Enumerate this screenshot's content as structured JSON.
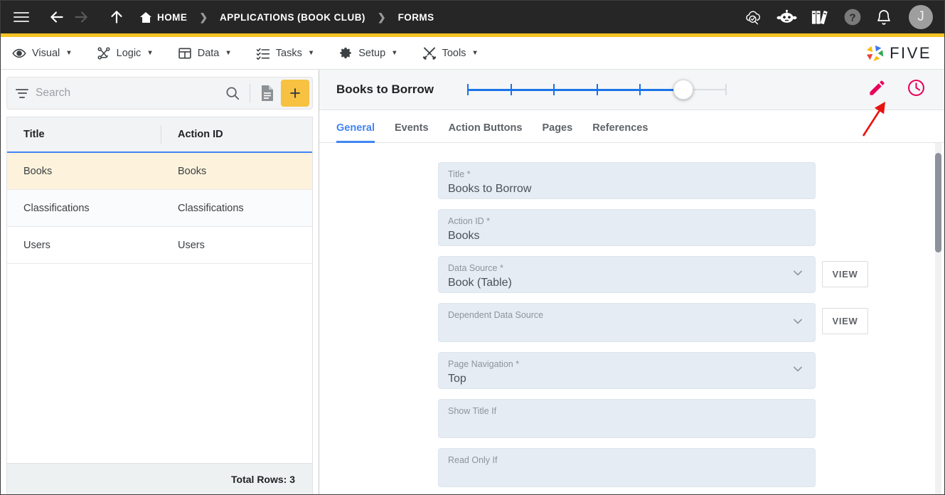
{
  "topbar": {
    "menu_icon": "hamburger-icon",
    "back_label": "←",
    "forward_label": "→",
    "up_label": "↑",
    "breadcrumb": [
      {
        "label": "HOME",
        "icon": "home-icon"
      },
      {
        "label": "APPLICATIONS (BOOK CLUB)",
        "icon": ""
      },
      {
        "label": "FORMS",
        "icon": ""
      }
    ],
    "separator": "❯",
    "icons": [
      {
        "name": "cloud-search-icon"
      },
      {
        "name": "chat-bot-icon"
      },
      {
        "name": "books-icon"
      },
      {
        "name": "help-icon"
      },
      {
        "name": "notifications-bell-icon"
      }
    ],
    "avatar_initial": "J",
    "accent_bar_color": "#f6c324",
    "background_color": "#262626"
  },
  "menubar": {
    "items": [
      {
        "label": "Visual",
        "icon": "eye-icon",
        "caret": "▼"
      },
      {
        "label": "Logic",
        "icon": "logic-nodes-icon",
        "caret": "▼"
      },
      {
        "label": "Data",
        "icon": "table-grid-icon",
        "caret": "▼"
      },
      {
        "label": "Tasks",
        "icon": "checklist-icon",
        "caret": "▼"
      },
      {
        "label": "Setup",
        "icon": "gear-icon",
        "caret": "▼"
      },
      {
        "label": "Tools",
        "icon": "tools-cross-icon",
        "caret": "▼"
      }
    ],
    "logo_text": "FIVE"
  },
  "sidebar": {
    "search": {
      "placeholder": "Search",
      "filter_icon": "filter-icon",
      "search_icon": "search-icon",
      "document_icon": "document-icon",
      "add_label": "+"
    },
    "table": {
      "columns": [
        "Title",
        "Action ID"
      ],
      "rows": [
        {
          "title": "Books",
          "action_id": "Books",
          "selected": true
        },
        {
          "title": "Classifications",
          "action_id": "Classifications",
          "selected": false
        },
        {
          "title": "Users",
          "action_id": "Users",
          "selected": false
        }
      ],
      "footer": "Total Rows: 3",
      "selected_row_color": "#fdf3dd"
    }
  },
  "main": {
    "title": "Books to Borrow",
    "slider": {
      "ticks": 7,
      "value": 6,
      "max": 7,
      "fill_color": "#1a73e8"
    },
    "header_icons": [
      {
        "name": "edit-pencil-icon",
        "color": "#e8005a"
      },
      {
        "name": "history-clock-icon",
        "color": "#e8005a"
      }
    ],
    "tabs": [
      {
        "label": "General",
        "active": true
      },
      {
        "label": "Events",
        "active": false
      },
      {
        "label": "Action Buttons",
        "active": false
      },
      {
        "label": "Pages",
        "active": false
      },
      {
        "label": "References",
        "active": false
      }
    ],
    "active_tab_color": "#4285f4",
    "fields": [
      {
        "label": "Title *",
        "value": "Books to Borrow",
        "type": "text",
        "view_button": null
      },
      {
        "label": "Action ID *",
        "value": "Books",
        "type": "text",
        "view_button": null
      },
      {
        "label": "Data Source *",
        "value": "Book (Table)",
        "type": "select",
        "view_button": "VIEW"
      },
      {
        "label": "Dependent Data Source",
        "value": "",
        "type": "select",
        "view_button": "VIEW"
      },
      {
        "label": "Page Navigation *",
        "value": "Top",
        "type": "select",
        "view_button": null
      },
      {
        "label": "Show Title If",
        "value": "",
        "type": "text",
        "view_button": null
      },
      {
        "label": "Read Only If",
        "value": "",
        "type": "text",
        "view_button": null
      }
    ]
  },
  "annotation": {
    "arrow_color": "#e8120e",
    "points_to": "edit-pencil-icon"
  }
}
